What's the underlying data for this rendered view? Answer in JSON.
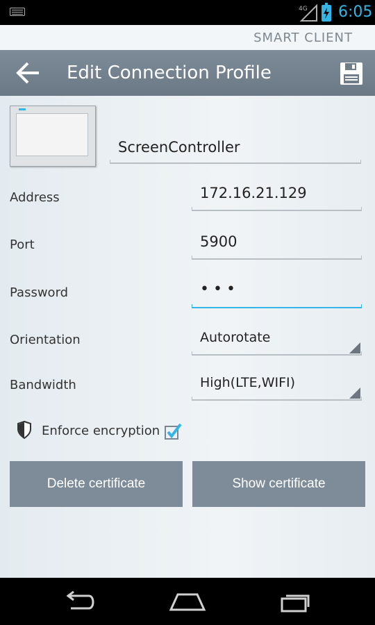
{
  "status_bar": {
    "time": "6:05",
    "network_label": "4G",
    "accent_color": "#33b5e5",
    "icons": [
      "keyboard-icon",
      "signal-icon",
      "battery-charging-icon"
    ]
  },
  "brand": {
    "text": "SMART CLIENT"
  },
  "action_bar": {
    "title": "Edit Connection Profile",
    "back_icon": "arrow-left-icon",
    "save_icon": "floppy-disk-icon"
  },
  "profile": {
    "name": "ScreenController",
    "thumbnail_icon": "screen-panel-icon"
  },
  "form": {
    "address": {
      "label": "Address",
      "value": "172.16.21.129"
    },
    "port": {
      "label": "Port",
      "value": "5900"
    },
    "password": {
      "label": "Password",
      "value": "•••"
    },
    "orientation": {
      "label": "Orientation",
      "value": "Autorotate"
    },
    "bandwidth": {
      "label": "Bandwidth",
      "value": "High(LTE,WIFI)"
    }
  },
  "encryption": {
    "label": "Enforce encryption",
    "checked": true,
    "icon": "shield-icon"
  },
  "buttons": {
    "delete_certificate": "Delete certificate",
    "show_certificate": "Show certificate"
  },
  "nav_bar": {
    "icons": [
      "back-nav-icon",
      "home-nav-icon",
      "recents-nav-icon"
    ]
  }
}
